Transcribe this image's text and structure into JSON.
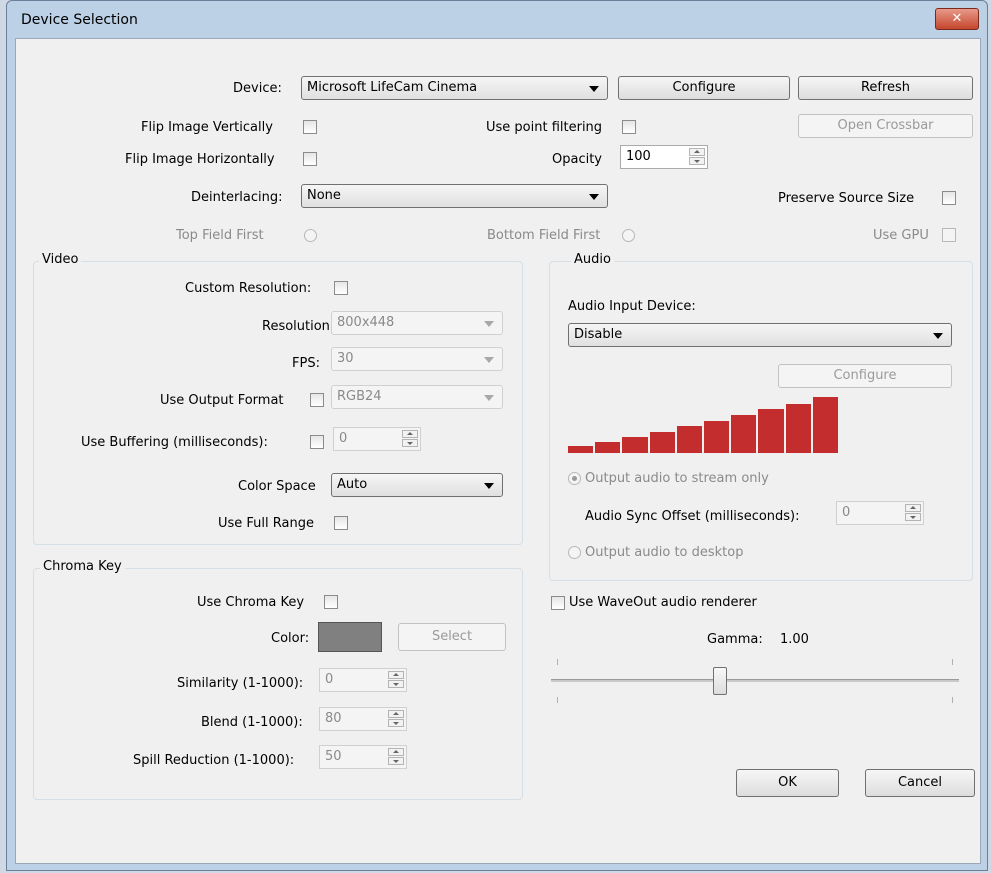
{
  "window": {
    "title": "Device Selection",
    "close_label": "✕"
  },
  "top": {
    "device_label": "Device:",
    "device_value": "Microsoft LifeCam Cinema",
    "configure_label": "Configure",
    "refresh_label": "Refresh",
    "flip_vertical_label": "Flip Image Vertically",
    "use_point_filtering_label": "Use point filtering",
    "open_crossbar_label": "Open Crossbar",
    "flip_horizontal_label": "Flip Image Horizontally",
    "opacity_label": "Opacity",
    "opacity_value": "100",
    "deinterlacing_label": "Deinterlacing:",
    "deinterlacing_value": "None",
    "preserve_source_size_label": "Preserve Source Size",
    "top_field_first_label": "Top Field First",
    "bottom_field_first_label": "Bottom Field First",
    "use_gpu_label": "Use GPU"
  },
  "video": {
    "title": "Video",
    "custom_resolution_label": "Custom Resolution:",
    "resolution_label": "Resolution",
    "resolution_value": "800x448",
    "fps_label": "FPS:",
    "fps_value": "30",
    "use_output_format_label": "Use Output Format",
    "output_format_value": "RGB24",
    "use_buffering_label": "Use Buffering (milliseconds):",
    "buffering_value": "0",
    "color_space_label": "Color Space",
    "color_space_value": "Auto",
    "use_full_range_label": "Use Full Range"
  },
  "chroma": {
    "title": "Chroma Key",
    "use_chroma_key_label": "Use Chroma Key",
    "color_label": "Color:",
    "color_swatch": "#808080",
    "select_label": "Select",
    "similarity_label": "Similarity (1-1000):",
    "similarity_value": "0",
    "blend_label": "Blend (1-1000):",
    "blend_value": "80",
    "spill_label": "Spill Reduction (1-1000):",
    "spill_value": "50"
  },
  "audio": {
    "title": "Audio",
    "input_device_label": "Audio Input Device:",
    "input_device_value": "Disable",
    "configure_label": "Configure",
    "meter_levels": [
      0.12,
      0.2,
      0.28,
      0.38,
      0.48,
      0.58,
      0.68,
      0.78,
      0.88,
      1.0
    ],
    "meter_color": "#c42d2d",
    "output_stream_label": "Output audio to stream only",
    "sync_offset_label": "Audio Sync Offset (milliseconds):",
    "sync_offset_value": "0",
    "output_desktop_label": "Output audio to desktop"
  },
  "waveout": {
    "label": "Use WaveOut audio renderer"
  },
  "gamma": {
    "label": "Gamma:",
    "value": "1.00",
    "slider_fraction": 0.41
  },
  "footer": {
    "ok_label": "OK",
    "cancel_label": "Cancel"
  }
}
